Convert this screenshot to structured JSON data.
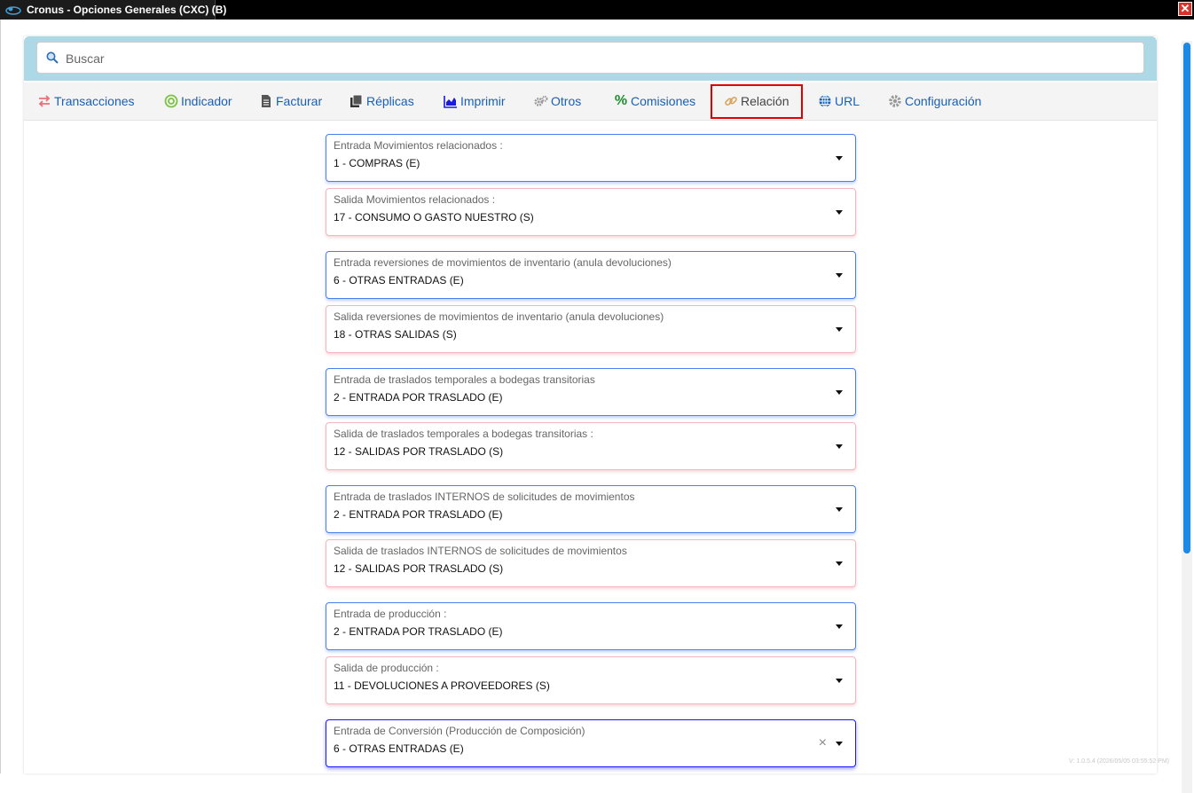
{
  "window": {
    "title": "Cronus - Opciones Generales (CXC) (B)",
    "close_glyph": "✕"
  },
  "search": {
    "placeholder": "Buscar",
    "value": ""
  },
  "tabs": [
    {
      "label": "Transacciones",
      "icon": "arrows-exchange-icon"
    },
    {
      "label": "Indicador",
      "icon": "target-icon"
    },
    {
      "label": "Facturar",
      "icon": "document-icon"
    },
    {
      "label": "Réplicas",
      "icon": "copy-icon"
    },
    {
      "label": "Imprimir",
      "icon": "area-chart-icon"
    },
    {
      "label": "Otros",
      "icon": "gears-icon"
    },
    {
      "label": "Comisiones",
      "icon": "percent-icon"
    },
    {
      "label": "Relación",
      "icon": "link-icon",
      "active": true
    },
    {
      "label": "URL",
      "icon": "globe-icon"
    },
    {
      "label": "Configuración",
      "icon": "gear-icon"
    }
  ],
  "fields": [
    {
      "label": "Entrada Movimientos relacionados :",
      "value": "1 - COMPRAS (E)"
    },
    {
      "label": "Salida Movimientos relacionados :",
      "value": "17 - CONSUMO O GASTO NUESTRO (S)"
    },
    {
      "label": "Entrada reversiones de movimientos de inventario (anula devoluciones)",
      "value": "6 - OTRAS ENTRADAS (E)"
    },
    {
      "label": "Salida reversiones de movimientos de inventario (anula devoluciones)",
      "value": "18 - OTRAS SALIDAS (S)"
    },
    {
      "label": "Entrada de traslados temporales a bodegas transitorias",
      "value": "2 - ENTRADA POR TRASLADO (E)"
    },
    {
      "label": "Salida de traslados temporales a bodegas transitorias :",
      "value": "12 - SALIDAS POR TRASLADO (S)"
    },
    {
      "label": "Entrada de traslados INTERNOS de solicitudes de movimientos",
      "value": "2 - ENTRADA POR TRASLADO (E)"
    },
    {
      "label": "Salida de traslados INTERNOS de solicitudes de movimientos",
      "value": "12 - SALIDAS POR TRASLADO (S)"
    },
    {
      "label": "Entrada de producción :",
      "value": "2 - ENTRADA POR TRASLADO (E)"
    },
    {
      "label": "Salida de producción :",
      "value": "11 - DEVOLUCIONES A PROVEEDORES (S)"
    },
    {
      "label": "Entrada de Conversión (Producción de Composición)",
      "value": "6 - OTRAS ENTRADAS (E)"
    }
  ],
  "clear_glyph": "×",
  "version": "V: 1.0.5.4 (2026/05/05 03:55:52 PM)",
  "colors": {
    "accent": "#1a5fb4",
    "active_border": "#e00000",
    "search_band": "#add8e6"
  }
}
